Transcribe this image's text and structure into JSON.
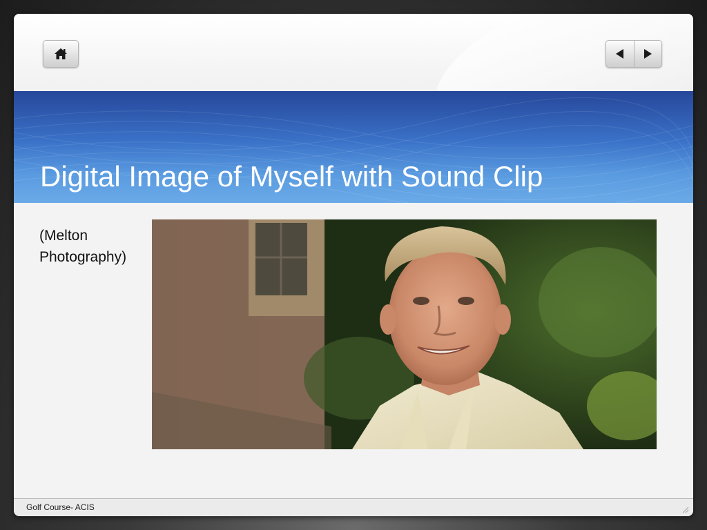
{
  "navigation": {
    "home": {
      "icon": "home-icon"
    },
    "previous": {
      "icon": "triangle-left-icon"
    },
    "next": {
      "icon": "triangle-right-icon"
    }
  },
  "slide": {
    "title": "Digital Image of Myself with Sound Clip",
    "caption_line1": "(Melton",
    "caption_line2": "Photography)",
    "photo": {
      "icon": "portrait-photo"
    }
  },
  "footer": {
    "text": "Golf Course- ACIS",
    "resize_icon": "resize-grip-icon"
  },
  "colors": {
    "title_band_dark": "#26479a",
    "title_band_light": "#6aaae8",
    "title_text": "#ffffff",
    "slide_background": "#f3f3f3"
  }
}
